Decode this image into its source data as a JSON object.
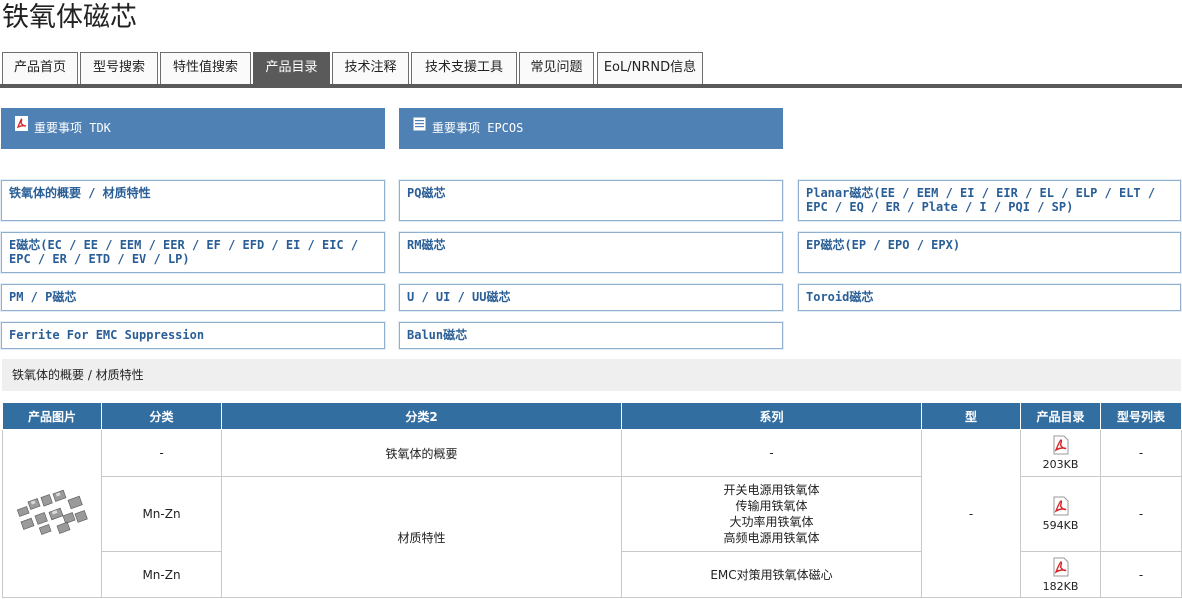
{
  "page_title": "铁氧体磁芯",
  "tabs": [
    {
      "label": "产品首页"
    },
    {
      "label": "型号搜索"
    },
    {
      "label": "特性值搜索"
    },
    {
      "label": "产品目录"
    },
    {
      "label": "技术注释"
    },
    {
      "label": "技术支援工具"
    },
    {
      "label": "常见问题"
    },
    {
      "label": "EoL/NRND信息"
    }
  ],
  "active_tab": "产品目录",
  "notices": [
    {
      "label": "重要事项 TDK",
      "icon": "pdf-icon"
    },
    {
      "label": "重要事项 EPCOS",
      "icon": "document-icon"
    }
  ],
  "categories": [
    "铁氧体的概要 / 材质特性",
    "PQ磁芯",
    "Planar磁芯(EE / EEM / EI / EIR / EL / ELP / ELT / EPC / EQ / ER / Plate / I / PQI / SP)",
    "E磁芯(EC / EE / EEM / EER / EF / EFD / EI / EIC / EPC / ER / ETD / EV / LP)",
    "RM磁芯",
    "EP磁芯(EP / EPO / EPX)",
    "PM / P磁芯",
    "U / UI / UU磁芯",
    "Toroid磁芯",
    "Ferrite For EMC Suppression",
    "Balun磁芯"
  ],
  "breadcrumb": "铁氧体的概要 / 材质特性",
  "table": {
    "headers": [
      "产品图片",
      "分类",
      "分类2",
      "系列",
      "型",
      "产品目录",
      "型号列表"
    ],
    "rows": [
      {
        "category": "-",
        "category2": "铁氧体的概要",
        "series": [
          "-"
        ],
        "catalog_size": "203KB",
        "part_list": "-"
      },
      {
        "category": "Mn-Zn",
        "category2": "材质特性",
        "series": [
          "开关电源用铁氧体",
          "传输用铁氧体",
          "大功率用铁氧体",
          "高频电源用铁氧体"
        ],
        "catalog_size": "594KB",
        "part_list": "-"
      },
      {
        "category": "Mn-Zn",
        "category2": "",
        "series": [
          "EMC对策用铁氧体磁心"
        ],
        "catalog_size": "182KB",
        "part_list": "-"
      }
    ],
    "type_value": "-"
  },
  "colors": {
    "accent": "#336ea1",
    "notice_bg": "#4f81b4",
    "link": "#2a5e96",
    "tab_active": "#5a5a5a",
    "pdf_red": "#d9262b"
  }
}
